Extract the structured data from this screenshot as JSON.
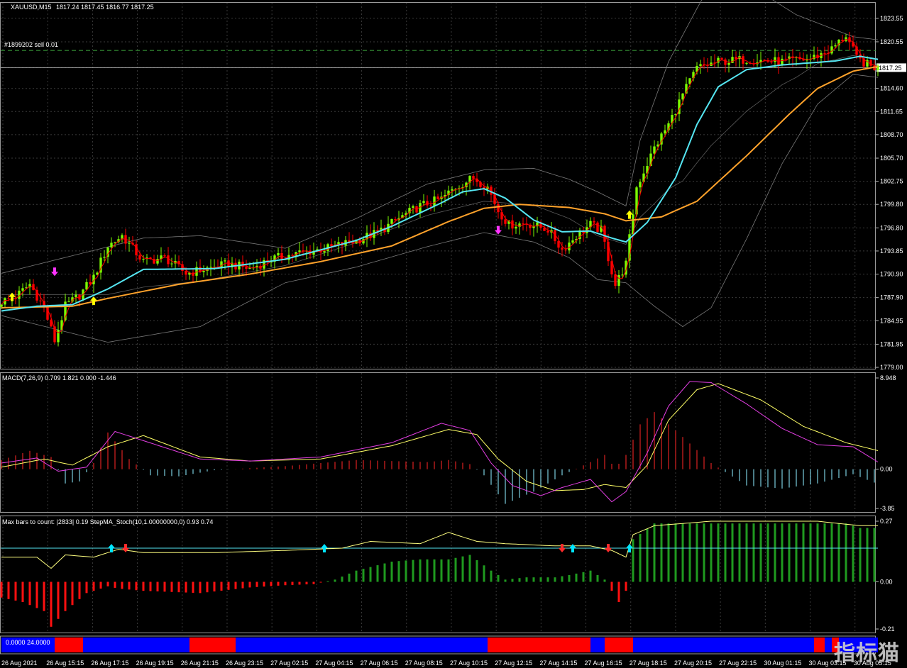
{
  "header": {
    "symbol": "XAUUSD,M15",
    "ohlc": "1817.24 1817.45 1816.77 1817.25",
    "order": "#1899202 sell 0.01",
    "current_price": "1817.25"
  },
  "colors": {
    "bull": "#7cfc00",
    "bear": "#ff0000",
    "ma_fast": "#55e6f2",
    "ma_slow": "#ffa22b",
    "signal": "#ff0000",
    "macd_line": "#e23ee2",
    "macd_signal": "#ffff66",
    "stoch_pos": "#1f9a1f",
    "stoch_neg": "#ff1010",
    "step_ma": "#ffff80",
    "stoch_level": "#55e6f2",
    "strip_red": "#ff0000",
    "strip_blue": "#0000ff"
  },
  "chart_data": [
    {
      "type": "candlestick",
      "title": "XAUUSD,M15",
      "yticks": [
        "1823.55",
        "1820.55",
        "1817.25",
        "1814.60",
        "1811.65",
        "1808.70",
        "1805.70",
        "1802.75",
        "1799.80",
        "1796.80",
        "1793.85",
        "1790.90",
        "1787.90",
        "1784.95",
        "1781.95",
        "1779.00"
      ],
      "ylim": [
        1779.0,
        1824.8
      ],
      "xticks": [
        "26 Aug 2021",
        "26 Aug 15:15",
        "26 Aug 17:15",
        "26 Aug 19:15",
        "26 Aug 21:15",
        "26 Aug 23:15",
        "27 Aug 02:15",
        "27 Aug 04:15",
        "27 Aug 06:15",
        "27 Aug 08:15",
        "27 Aug 10:15",
        "27 Aug 12:15",
        "27 Aug 14:15",
        "27 Aug 16:15",
        "27 Aug 18:15",
        "27 Aug 20:15",
        "27 Aug 22:15",
        "30 Aug 01:15",
        "30 Aug 03:15",
        "30 Aug 05:15"
      ],
      "price_path": [
        [
          0,
          1787.4
        ],
        [
          4,
          1788.0
        ],
        [
          8,
          1789.6
        ],
        [
          12,
          1786.6
        ],
        [
          15,
          1782.4
        ],
        [
          18,
          1786.8
        ],
        [
          22,
          1788.2
        ],
        [
          26,
          1790.5
        ],
        [
          30,
          1794.5
        ],
        [
          34,
          1795.8
        ],
        [
          40,
          1792.5
        ],
        [
          46,
          1793.0
        ],
        [
          52,
          1791.0
        ],
        [
          58,
          1791.6
        ],
        [
          64,
          1792.2
        ],
        [
          70,
          1791.6
        ],
        [
          76,
          1792.8
        ],
        [
          84,
          1793.6
        ],
        [
          92,
          1794.2
        ],
        [
          100,
          1795.2
        ],
        [
          106,
          1796.2
        ],
        [
          112,
          1798.0
        ],
        [
          118,
          1799.6
        ],
        [
          124,
          1800.5
        ],
        [
          128,
          1802.0
        ],
        [
          133,
          1803.2
        ],
        [
          137,
          1802.0
        ],
        [
          140,
          1799.0
        ],
        [
          143,
          1797.2
        ],
        [
          148,
          1797.4
        ],
        [
          154,
          1796.6
        ],
        [
          158,
          1794.0
        ],
        [
          162,
          1795.8
        ],
        [
          166,
          1797.2
        ],
        [
          169,
          1796.5
        ],
        [
          173,
          1789.5
        ],
        [
          176,
          1792.2
        ],
        [
          179,
          1802.0
        ],
        [
          184,
          1807.0
        ],
        [
          188,
          1810.0
        ],
        [
          192,
          1813.8
        ],
        [
          196,
          1817.2
        ],
        [
          202,
          1818.0
        ],
        [
          210,
          1818.3
        ],
        [
          220,
          1818.0
        ],
        [
          228,
          1818.4
        ],
        [
          234,
          1819.6
        ],
        [
          238,
          1821.4
        ],
        [
          241,
          1818.4
        ],
        [
          245,
          1817.4
        ],
        [
          247,
          1817.25
        ]
      ],
      "ma_fast_path": [
        [
          0,
          1786.2
        ],
        [
          10,
          1786.8
        ],
        [
          20,
          1787.0
        ],
        [
          30,
          1789.0
        ],
        [
          40,
          1791.5
        ],
        [
          60,
          1791.6
        ],
        [
          80,
          1792.8
        ],
        [
          100,
          1795.2
        ],
        [
          110,
          1797.0
        ],
        [
          124,
          1800.0
        ],
        [
          130,
          1801.4
        ],
        [
          136,
          1801.8
        ],
        [
          142,
          1800.6
        ],
        [
          150,
          1797.8
        ],
        [
          158,
          1796.3
        ],
        [
          166,
          1796.4
        ],
        [
          172,
          1795.5
        ],
        [
          176,
          1795.0
        ],
        [
          182,
          1797.5
        ],
        [
          190,
          1803.2
        ],
        [
          196,
          1810.0
        ],
        [
          202,
          1814.8
        ],
        [
          210,
          1817.0
        ],
        [
          220,
          1817.6
        ],
        [
          235,
          1818.1
        ],
        [
          242,
          1818.7
        ],
        [
          247,
          1818.3
        ]
      ],
      "ma_slow_path": [
        [
          0,
          1786.6
        ],
        [
          20,
          1786.8
        ],
        [
          30,
          1787.8
        ],
        [
          50,
          1789.6
        ],
        [
          70,
          1790.9
        ],
        [
          90,
          1792.5
        ],
        [
          110,
          1794.5
        ],
        [
          126,
          1797.6
        ],
        [
          136,
          1799.3
        ],
        [
          146,
          1799.8
        ],
        [
          160,
          1799.4
        ],
        [
          170,
          1798.6
        ],
        [
          176,
          1797.7
        ],
        [
          186,
          1798.2
        ],
        [
          196,
          1800.2
        ],
        [
          210,
          1806.0
        ],
        [
          222,
          1811.3
        ],
        [
          230,
          1814.6
        ],
        [
          240,
          1816.8
        ],
        [
          247,
          1817.4
        ]
      ],
      "bb_upper_path": [
        [
          0,
          1791.0
        ],
        [
          40,
          1795.5
        ],
        [
          56,
          1795.8
        ],
        [
          80,
          1794.2
        ],
        [
          100,
          1798.0
        ],
        [
          120,
          1802.4
        ],
        [
          136,
          1804.2
        ],
        [
          150,
          1804.4
        ],
        [
          160,
          1803.0
        ],
        [
          168,
          1801.4
        ],
        [
          176,
          1799.6
        ],
        [
          180,
          1808.0
        ],
        [
          188,
          1818.0
        ],
        [
          196,
          1824.8
        ],
        [
          200,
          1828.0
        ],
        [
          210,
          1828.0
        ],
        [
          224,
          1824.0
        ],
        [
          240,
          1821.2
        ],
        [
          247,
          1820.8
        ]
      ],
      "bb_lower_path": [
        [
          0,
          1785.6
        ],
        [
          30,
          1782.2
        ],
        [
          56,
          1784.2
        ],
        [
          80,
          1789.8
        ],
        [
          100,
          1791.8
        ],
        [
          120,
          1794.4
        ],
        [
          136,
          1796.2
        ],
        [
          150,
          1795.0
        ],
        [
          160,
          1793.0
        ],
        [
          168,
          1790.2
        ],
        [
          176,
          1789.8
        ],
        [
          184,
          1786.8
        ],
        [
          192,
          1784.2
        ],
        [
          200,
          1786.6
        ],
        [
          210,
          1795.4
        ],
        [
          220,
          1805.0
        ],
        [
          230,
          1812.6
        ],
        [
          240,
          1816.4
        ],
        [
          247,
          1816.0
        ]
      ],
      "buy_signals": [
        [
          3,
          1788.0
        ],
        [
          26,
          1787.5
        ],
        [
          177,
          1798.5
        ]
      ],
      "sell_signals": [
        [
          15,
          1791.2
        ],
        [
          140,
          1796.5
        ]
      ]
    },
    {
      "type": "bar",
      "title": "MACD(7,26,9) 0.709 1.821 0.000 -1.446",
      "yticks": [
        "8.948",
        "0.00",
        "-3.85"
      ],
      "ylim": [
        -3.85,
        8.948
      ],
      "hist_path": [
        [
          0,
          0.9
        ],
        [
          8,
          1.8
        ],
        [
          14,
          1.2
        ],
        [
          18,
          -1.4
        ],
        [
          22,
          -1.2
        ],
        [
          26,
          0.6
        ],
        [
          30,
          3.6
        ],
        [
          36,
          1.0
        ],
        [
          42,
          -0.6
        ],
        [
          50,
          -0.7
        ],
        [
          60,
          -0.1
        ],
        [
          80,
          0.3
        ],
        [
          100,
          0.9
        ],
        [
          120,
          0.7
        ],
        [
          126,
          0.9
        ],
        [
          132,
          0.5
        ],
        [
          136,
          -0.6
        ],
        [
          142,
          -3.4
        ],
        [
          150,
          -2.2
        ],
        [
          158,
          -0.6
        ],
        [
          166,
          0.7
        ],
        [
          170,
          1.4
        ],
        [
          173,
          0.1
        ],
        [
          176,
          1.4
        ],
        [
          180,
          4.4
        ],
        [
          184,
          5.6
        ],
        [
          190,
          3.8
        ],
        [
          200,
          0.6
        ],
        [
          210,
          -1.6
        ],
        [
          220,
          -1.9
        ],
        [
          230,
          -1.4
        ],
        [
          240,
          -0.5
        ],
        [
          247,
          -1.45
        ]
      ],
      "macd_path": [
        [
          0,
          0.6
        ],
        [
          10,
          1.1
        ],
        [
          16,
          -0.2
        ],
        [
          24,
          0.2
        ],
        [
          32,
          3.7
        ],
        [
          40,
          2.8
        ],
        [
          56,
          1.0
        ],
        [
          70,
          0.8
        ],
        [
          90,
          1.2
        ],
        [
          110,
          2.6
        ],
        [
          124,
          4.5
        ],
        [
          132,
          3.8
        ],
        [
          138,
          0.6
        ],
        [
          144,
          -1.6
        ],
        [
          152,
          -2.6
        ],
        [
          158,
          -1.8
        ],
        [
          166,
          -1.0
        ],
        [
          172,
          -3.2
        ],
        [
          176,
          -2.2
        ],
        [
          182,
          1.6
        ],
        [
          188,
          6.2
        ],
        [
          194,
          8.6
        ],
        [
          200,
          8.5
        ],
        [
          210,
          6.4
        ],
        [
          220,
          4.0
        ],
        [
          230,
          2.4
        ],
        [
          240,
          2.2
        ],
        [
          247,
          0.709
        ]
      ],
      "signal_path": [
        [
          0,
          0.2
        ],
        [
          12,
          1.0
        ],
        [
          20,
          0.4
        ],
        [
          30,
          2.2
        ],
        [
          40,
          3.3
        ],
        [
          56,
          1.2
        ],
        [
          70,
          0.8
        ],
        [
          90,
          1.0
        ],
        [
          110,
          2.3
        ],
        [
          126,
          3.9
        ],
        [
          134,
          3.4
        ],
        [
          140,
          1.0
        ],
        [
          148,
          -1.2
        ],
        [
          156,
          -2.1
        ],
        [
          164,
          -2.0
        ],
        [
          170,
          -1.5
        ],
        [
          176,
          -1.8
        ],
        [
          182,
          0.4
        ],
        [
          188,
          4.8
        ],
        [
          196,
          7.8
        ],
        [
          202,
          8.4
        ],
        [
          214,
          6.8
        ],
        [
          226,
          4.2
        ],
        [
          238,
          2.6
        ],
        [
          247,
          1.821
        ]
      ]
    },
    {
      "type": "bar",
      "title": "Max bars to count: |2833| 0.19 StepMA_Stoch(10,1.00000000,0) 0.93 0.74",
      "yticks": [
        "0.27",
        "0.00",
        "-0.21"
      ],
      "ylim": [
        -0.21,
        0.27
      ],
      "hist_path": [
        [
          0,
          -0.07
        ],
        [
          6,
          -0.09
        ],
        [
          12,
          -0.13
        ],
        [
          14,
          -0.2
        ],
        [
          18,
          -0.13
        ],
        [
          24,
          -0.05
        ],
        [
          30,
          -0.02
        ],
        [
          33,
          -0.03
        ],
        [
          40,
          -0.04
        ],
        [
          56,
          -0.05
        ],
        [
          70,
          -0.025
        ],
        [
          80,
          -0.015
        ],
        [
          88,
          -0.01
        ],
        [
          94,
          0.01
        ],
        [
          100,
          0.05
        ],
        [
          110,
          0.09
        ],
        [
          118,
          0.1
        ],
        [
          126,
          0.1
        ],
        [
          132,
          0.12
        ],
        [
          138,
          0.05
        ],
        [
          142,
          0.01
        ],
        [
          148,
          0.02
        ],
        [
          156,
          0.02
        ],
        [
          160,
          0.03
        ],
        [
          166,
          0.05
        ],
        [
          170,
          0.01
        ],
        [
          172,
          -0.04
        ],
        [
          174,
          -0.09
        ],
        [
          176,
          -0.04
        ],
        [
          178,
          0.19
        ],
        [
          184,
          0.26
        ],
        [
          200,
          0.26
        ],
        [
          220,
          0.26
        ],
        [
          238,
          0.26
        ],
        [
          242,
          0.24
        ],
        [
          247,
          0.24
        ]
      ],
      "step_path": [
        [
          0,
          0.11
        ],
        [
          10,
          0.11
        ],
        [
          14,
          0.06
        ],
        [
          18,
          0.12
        ],
        [
          26,
          0.11
        ],
        [
          33,
          0.145
        ],
        [
          40,
          0.13
        ],
        [
          60,
          0.13
        ],
        [
          80,
          0.14
        ],
        [
          96,
          0.15
        ],
        [
          104,
          0.18
        ],
        [
          118,
          0.17
        ],
        [
          126,
          0.22
        ],
        [
          134,
          0.18
        ],
        [
          142,
          0.17
        ],
        [
          156,
          0.16
        ],
        [
          166,
          0.16
        ],
        [
          172,
          0.14
        ],
        [
          176,
          0.11
        ],
        [
          178,
          0.21
        ],
        [
          184,
          0.25
        ],
        [
          200,
          0.27
        ],
        [
          230,
          0.27
        ],
        [
          242,
          0.25
        ],
        [
          247,
          0.25
        ]
      ],
      "level": 0.15,
      "buy_signals": [
        31,
        91,
        161,
        177
      ],
      "sell_signals": [
        35,
        158,
        171
      ]
    },
    {
      "type": "bar",
      "title": "0.0000 24.0000",
      "segments": [
        [
          0,
          15,
          "blue"
        ],
        [
          15,
          23,
          "red"
        ],
        [
          23,
          53,
          "blue"
        ],
        [
          53,
          66,
          "red"
        ],
        [
          66,
          137,
          "blue"
        ],
        [
          137,
          166,
          "red"
        ],
        [
          166,
          170,
          "blue"
        ],
        [
          170,
          178,
          "red"
        ],
        [
          178,
          229,
          "blue"
        ],
        [
          229,
          232,
          "red"
        ],
        [
          232,
          234,
          "blue"
        ],
        [
          234,
          236,
          "red"
        ],
        [
          236,
          247,
          "blue"
        ]
      ]
    }
  ],
  "watermark": "指标猫"
}
